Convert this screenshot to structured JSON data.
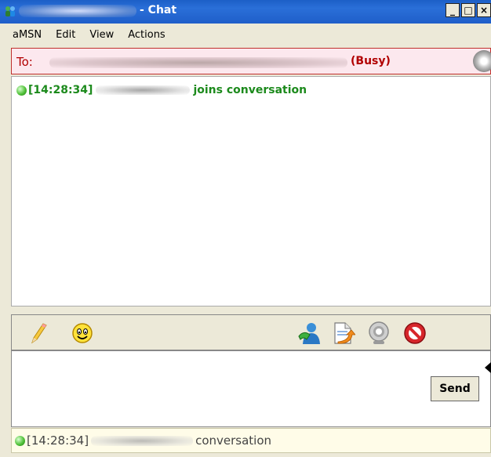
{
  "window": {
    "title": "- Chat",
    "minimize": "_",
    "maximize": "□",
    "close": "×"
  },
  "menu": [
    "aMSN",
    "Edit",
    "View",
    "Actions"
  ],
  "to_bar": {
    "label": "To:",
    "contact_suffix": "(Busy)"
  },
  "chat_log": {
    "timestamp": "[14:28:34]",
    "message_tail": "joins conversation"
  },
  "toolbar": {
    "icons": [
      "pencil-icon",
      "smiley-icon",
      "contact-invite-icon",
      "send-file-icon",
      "webcam-icon",
      "block-icon"
    ]
  },
  "input": {
    "send_label": "Send"
  },
  "status": {
    "timestamp": "[14:28:34]",
    "message_tail": "conversation"
  }
}
